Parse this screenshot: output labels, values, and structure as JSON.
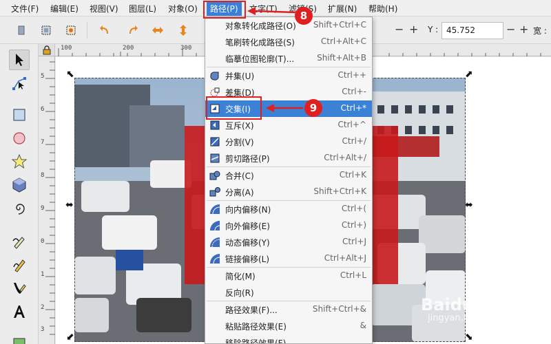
{
  "menubar": {
    "items": [
      "文件(F)",
      "编辑(E)",
      "视图(V)",
      "图层(L)",
      "对象(O)",
      "路径(P)",
      "文字(T)",
      "滤镜(S)",
      "扩展(N)",
      "帮助(H)"
    ]
  },
  "toolbar": {
    "y_label": "Y :",
    "y_value": "45.752",
    "w_label": "宽 :",
    "minus": "−",
    "plus": "+"
  },
  "ruler": {
    "top_labels": [
      "100",
      "200",
      "300"
    ],
    "left_labels": [
      "5",
      "6",
      "7",
      "8",
      "9",
      "0",
      "1",
      "2",
      "3",
      "4"
    ]
  },
  "path_menu": {
    "items": [
      {
        "label": "对象转化成路径(O)",
        "shortcut": "Shift+Ctrl+C",
        "icon": ""
      },
      {
        "label": "笔刷转化成路径(S)",
        "shortcut": "Ctrl+Alt+C",
        "icon": ""
      },
      {
        "label": "临摹位图轮廓(T)...",
        "shortcut": "Shift+Alt+B",
        "icon": ""
      },
      {
        "label": "并集(U)",
        "shortcut": "Ctrl++",
        "icon": "union-icon"
      },
      {
        "label": "差集(D)",
        "shortcut": "Ctrl+-",
        "icon": "difference-icon"
      },
      {
        "label": "交集(I)",
        "shortcut": "Ctrl+*",
        "icon": "intersection-icon"
      },
      {
        "label": "互斥(X)",
        "shortcut": "Ctrl+^",
        "icon": "exclusion-icon"
      },
      {
        "label": "分割(V)",
        "shortcut": "Ctrl+/",
        "icon": "division-icon"
      },
      {
        "label": "剪切路径(P)",
        "shortcut": "Ctrl+Alt+/",
        "icon": "cut-path-icon"
      },
      {
        "label": "合并(C)",
        "shortcut": "Ctrl+K",
        "icon": "combine-icon"
      },
      {
        "label": "分离(A)",
        "shortcut": "Shift+Ctrl+K",
        "icon": "break-apart-icon"
      },
      {
        "label": "向内偏移(N)",
        "shortcut": "Ctrl+(",
        "icon": "inset-icon"
      },
      {
        "label": "向外偏移(E)",
        "shortcut": "Ctrl+)",
        "icon": "outset-icon"
      },
      {
        "label": "动态偏移(Y)",
        "shortcut": "Ctrl+J",
        "icon": "dynamic-offset-icon"
      },
      {
        "label": "链接偏移(L)",
        "shortcut": "Ctrl+Alt+J",
        "icon": "linked-offset-icon"
      },
      {
        "label": "简化(M)",
        "shortcut": "Ctrl+L",
        "icon": ""
      },
      {
        "label": "反向(R)",
        "shortcut": "",
        "icon": ""
      },
      {
        "label": "路径效果(F)...",
        "shortcut": "Shift+Ctrl+&",
        "icon": ""
      },
      {
        "label": "粘贴路径效果(E)",
        "shortcut": "&",
        "icon": ""
      },
      {
        "label": "移除路径效果(F)",
        "shortcut": "",
        "icon": ""
      }
    ],
    "highlighted": "交集(I)"
  },
  "annotations": {
    "step_8": "8",
    "step_9": "9"
  },
  "watermark": {
    "brand": "Baidu 经验",
    "url": "jingyan.baidu.com"
  },
  "colors": {
    "accent": "#3b82d6",
    "annotation_red": "#e02020",
    "shape_red": "#c8191c"
  }
}
